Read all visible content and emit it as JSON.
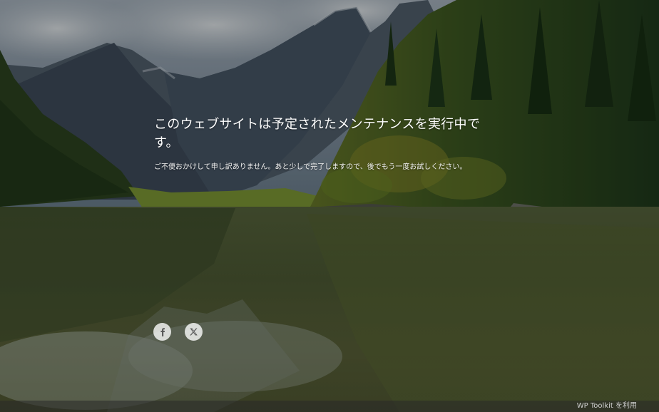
{
  "main": {
    "headline": "このウェブサイトは予定されたメンテナンスを実行中です。",
    "subtext": "ご不便おかけして申し訳ありません。あと少しで完了しますので、後でもう一度お試しください。"
  },
  "social": {
    "facebook_icon": "facebook-icon",
    "x_icon": "x-icon"
  },
  "footer": {
    "link_label": "WP Toolkit を利用"
  },
  "colors": {
    "text": "#ffffff",
    "social_button_bg": "#e6e6e6",
    "footer_bar": "#282828",
    "footer_text": "#cfcfcf"
  }
}
